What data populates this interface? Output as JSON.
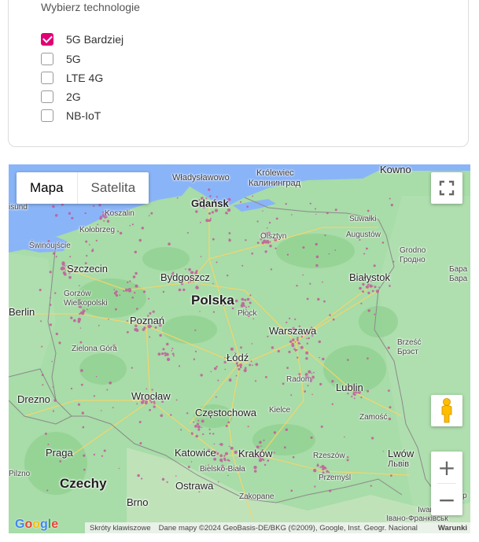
{
  "filter": {
    "title": "Wybierz technologie",
    "options": [
      {
        "label": "5G Bardziej",
        "checked": true
      },
      {
        "label": "5G",
        "checked": false
      },
      {
        "label": "LTE 4G",
        "checked": false
      },
      {
        "label": "2G",
        "checked": false
      },
      {
        "label": "NB-IoT",
        "checked": false
      }
    ]
  },
  "map": {
    "type_buttons": {
      "map": "Mapa",
      "satellite": "Satelita"
    },
    "accent_color": "#e20074",
    "places": {
      "wladyslawowo": "Władysławowo",
      "krolewiec": "Królewiec",
      "kaliningrad": "Калининград",
      "kowno": "Kowno",
      "gdansk": "Gdańsk",
      "koszalin": "Koszalin",
      "kolobrzeg": "Kołobrzeg",
      "swinoujscie": "Świnoujście",
      "isund": "isund",
      "suwalki": "Suwałki",
      "augustow": "Augustów",
      "olsztyn": "Olsztyn",
      "grodno": "Grodno",
      "grodno_ru": "Гродно",
      "szczecin": "Szczecin",
      "bydgoszcz": "Bydgoszcz",
      "bialystok": "Białystok",
      "bara": "Бара",
      "bara2": "Бара",
      "polska": "Polska",
      "gorzow": "Gorzów Wielkopolski",
      "berlin": "Berlin",
      "plock": "Płock",
      "poznan": "Poznań",
      "warszawa": "Warszawa",
      "zielona_gora": "Zielona Góra",
      "brzesc": "Brześć",
      "brest_ru": "Брэст",
      "lodz": "Łódź",
      "drezno": "Drezno",
      "radom": "Radom",
      "lublin": "Lublin",
      "wroclaw": "Wrocław",
      "czestochowa": "Częstochowa",
      "kielce": "Kielce",
      "zamosc": "Zamość",
      "praga": "Praga",
      "katowice": "Katowice",
      "krakow": "Kraków",
      "rzeszow": "Rzeszów",
      "lwow": "Lwów",
      "lwow_uk": "Львів",
      "pilzno": "Pilzno",
      "bielsko": "Bielsko-Biała",
      "ostrawa": "Ostrawa",
      "przemysl": "Przemyśl",
      "czechy": "Czechy",
      "brno": "Brno",
      "zakopane": "Zakopane",
      "ivano": "Iwano-Frank",
      "ivano_uk": "Івано-Франківськ",
      "ter": "Тер"
    },
    "attribution": {
      "shortcuts": "Skróty klawiszowe",
      "data": "Dane mapy ©2024 GeoBasis-DE/BKG (©2009), Google, Inst. Geogr. Nacional",
      "terms": "Warunki"
    },
    "google_logo": "Google",
    "controls": {
      "fullscreen_icon": "fullscreen-icon",
      "pegman_icon": "pegman-icon",
      "zoom_in": "+",
      "zoom_out": "−"
    }
  }
}
